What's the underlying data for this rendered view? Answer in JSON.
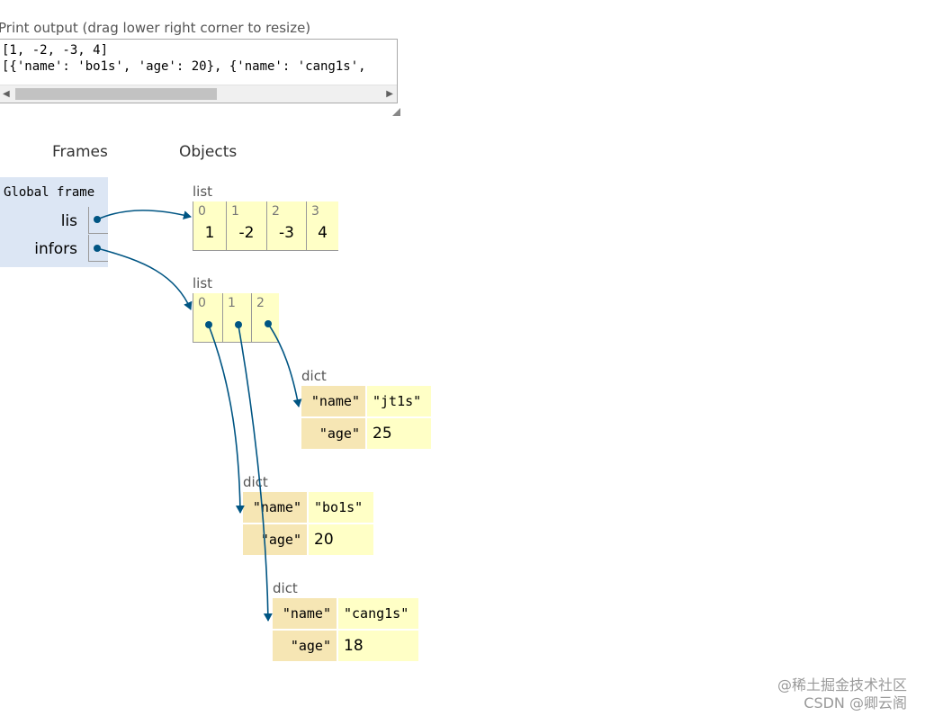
{
  "print_output": {
    "label": "Print output (drag lower right corner to resize)",
    "lines": [
      "[1, -2, -3, 4]",
      "[{'name': 'bo1s', 'age': 20}, {'name': 'cang1s',"
    ]
  },
  "headings": {
    "frames": "Frames",
    "objects": "Objects"
  },
  "global_frame": {
    "title": "Global frame",
    "vars": [
      "lis",
      "infors"
    ]
  },
  "list1": {
    "type": "list",
    "indices": [
      "0",
      "1",
      "2",
      "3"
    ],
    "values": [
      "1",
      "-2",
      "-3",
      "4"
    ]
  },
  "list2": {
    "type": "list",
    "indices": [
      "0",
      "1",
      "2"
    ]
  },
  "dict_jt": {
    "type": "dict",
    "keys": [
      "\"name\"",
      "\"age\""
    ],
    "values": [
      "\"jt1s\"",
      "25"
    ]
  },
  "dict_bo": {
    "type": "dict",
    "keys": [
      "\"name\"",
      "\"age\""
    ],
    "values": [
      "\"bo1s\"",
      "20"
    ]
  },
  "dict_cang": {
    "type": "dict",
    "keys": [
      "\"name\"",
      "\"age\""
    ],
    "values": [
      "\"cang1s\"",
      "18"
    ]
  },
  "watermark": {
    "line1": "@稀土掘金技术社区",
    "line2": "CSDN @卿云阁"
  },
  "colors": {
    "arrow": "#005583",
    "frame_bg": "#dce6f4",
    "cell_bg": "#ffffc6",
    "key_bg": "#f6e6b4"
  }
}
